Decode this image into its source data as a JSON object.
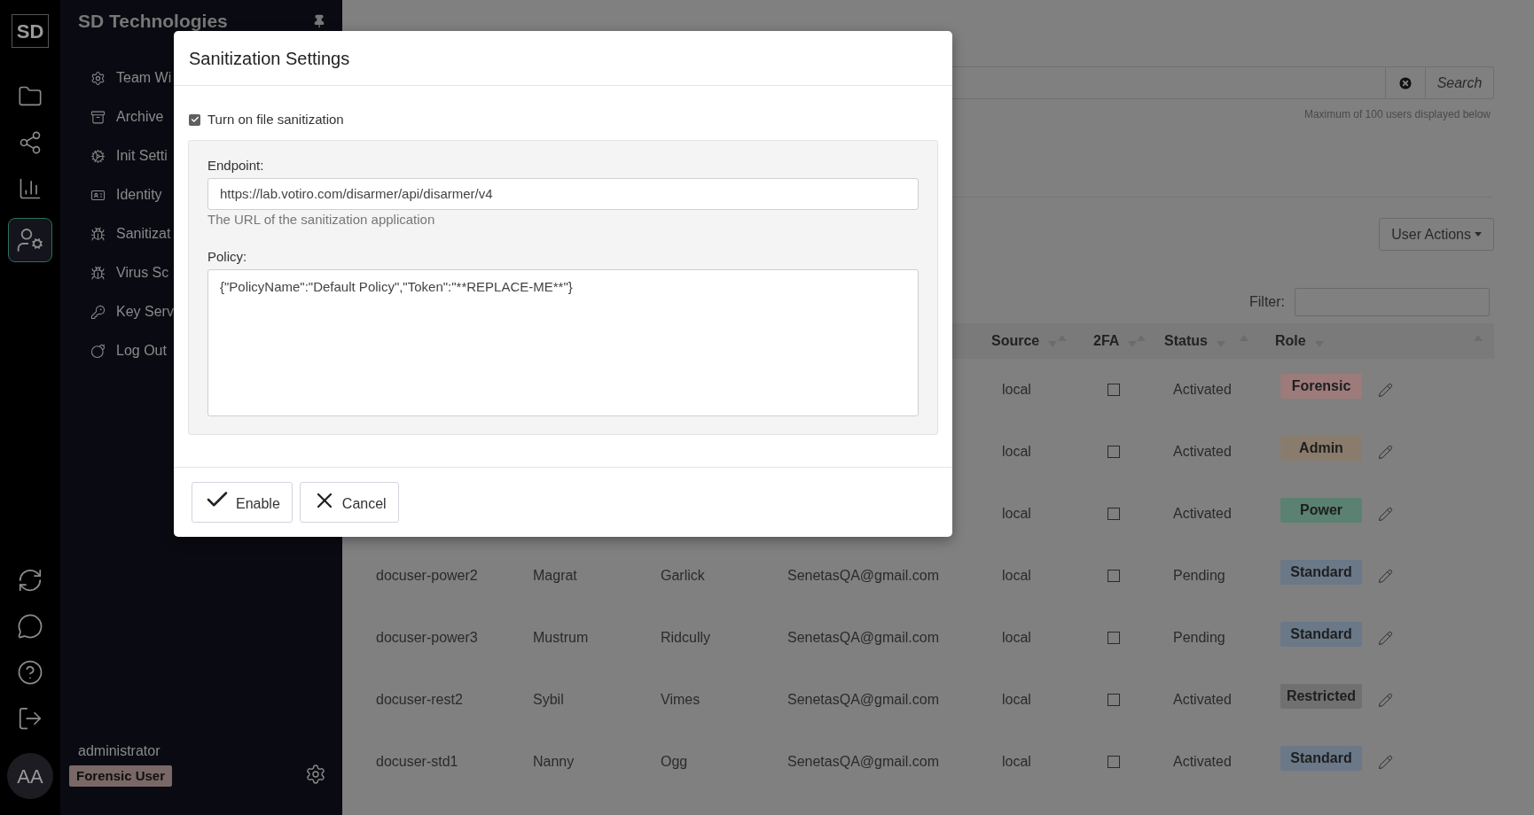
{
  "rail": {
    "logo": "SD",
    "items": [
      {
        "selected": false
      },
      {
        "selected": false
      },
      {
        "selected": false
      },
      {
        "selected": true
      }
    ],
    "avatar": "AA"
  },
  "sidebar": {
    "title": "SD Technologies",
    "items": [
      "Team Wi",
      "Archive",
      "Init Setti",
      "Identity",
      "Sanitizat",
      "Virus Sc",
      "Key Serv",
      "Log Out"
    ],
    "user": {
      "name": "administrator",
      "role": "Forensic User"
    }
  },
  "main": {
    "search": {
      "button": "Search",
      "note": "Maximum of 100 users displayed below"
    },
    "user_actions": "User Actions",
    "filter": {
      "label": "Filter:"
    },
    "table": {
      "columns": [
        "Source",
        "2FA",
        "Status",
        "Role"
      ],
      "rows": [
        {
          "source": "local",
          "two_fa": false,
          "status": "Activated",
          "role": "Forensic",
          "color": "#9c7b7a"
        },
        {
          "source": "local",
          "two_fa": false,
          "status": "Activated",
          "role": "Admin",
          "color": "#8a7c6c"
        },
        {
          "source": "local",
          "two_fa": false,
          "status": "Activated",
          "role": "Power",
          "color": "#5a8172"
        },
        {
          "username": "docuser-power2",
          "first_name": "Magrat",
          "last_name": "Garlick",
          "email": "SenetasQA@gmail.com",
          "source": "local",
          "two_fa": false,
          "status": "Pending",
          "role": "Standard",
          "color": "#6a7888"
        },
        {
          "username": "docuser-power3",
          "first_name": "Mustrum",
          "last_name": "Ridcully",
          "email": "SenetasQA@gmail.com",
          "source": "local",
          "two_fa": false,
          "status": "Pending",
          "role": "Standard",
          "color": "#6a7888"
        },
        {
          "username": "docuser-rest2",
          "first_name": "Sybil",
          "last_name": "Vimes",
          "email": "SenetasQA@gmail.com",
          "source": "local",
          "two_fa": false,
          "status": "Activated",
          "role": "Restricted",
          "color": "#707070"
        },
        {
          "username": "docuser-std1",
          "first_name": "Nanny",
          "last_name": "Ogg",
          "email": "SenetasQA@gmail.com",
          "source": "local",
          "two_fa": false,
          "status": "Activated",
          "role": "Standard",
          "color": "#6a7888"
        }
      ]
    }
  },
  "dialog": {
    "title": "Sanitization Settings",
    "enable_checkbox": {
      "label": "Turn on file sanitization",
      "checked": true
    },
    "endpoint": {
      "label": "Endpoint:",
      "value": "https://lab.votiro.com/disarmer/api/disarmer/v4",
      "help": "The URL of the sanitization application"
    },
    "policy": {
      "label": "Policy:",
      "value": "{\"PolicyName\":\"Default Policy\",\"Token\":\"**REPLACE-ME**\"}"
    },
    "buttons": [
      "Enable",
      "Cancel"
    ]
  }
}
